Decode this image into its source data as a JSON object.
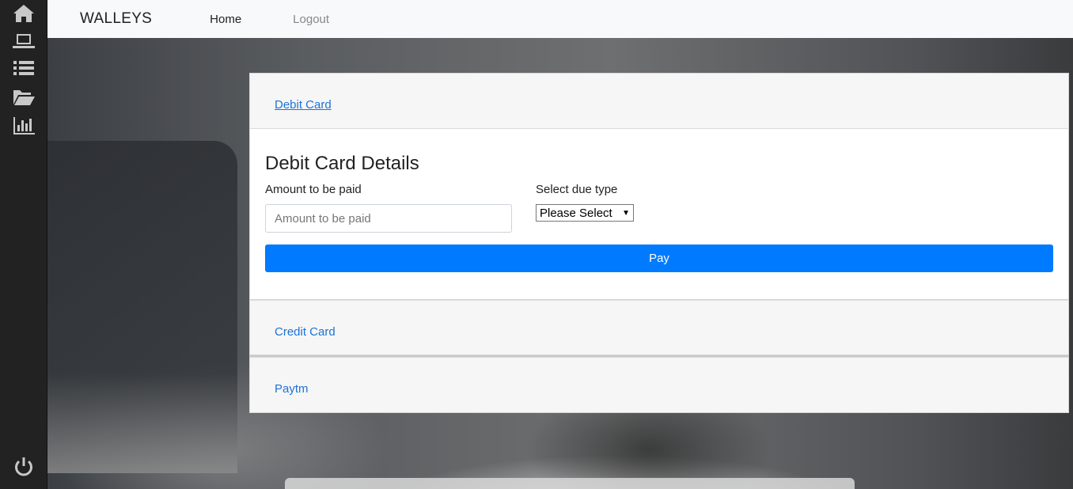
{
  "sidebar": {
    "icons": [
      "home-icon",
      "laptop-icon",
      "list-icon",
      "folder-open-icon",
      "bar-chart-icon",
      "power-icon"
    ]
  },
  "navbar": {
    "brand": "WALLEYS",
    "home": "Home",
    "logout": "Logout"
  },
  "accordion": {
    "debit_header": "Debit Card",
    "debit_title": "Debit Card Details",
    "amount_label": "Amount to be paid",
    "amount_placeholder": "Amount to be paid",
    "due_label": "Select due type",
    "due_selected": "Please Select",
    "pay_label": "Pay",
    "credit_header": "Credit Card",
    "paytm_header": "Paytm"
  },
  "colors": {
    "accent": "#007bff",
    "link": "#1a73d9",
    "sidebar": "#222222"
  }
}
